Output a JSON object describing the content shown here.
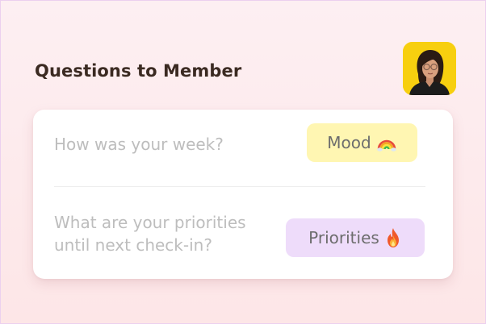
{
  "header": {
    "title": "Questions to Member"
  },
  "avatar": {
    "icon": "member-photo"
  },
  "questions": [
    {
      "text": "How was your week?",
      "tag": {
        "label": "Mood",
        "icon": "rainbow-icon",
        "color": "#fff6b2"
      }
    },
    {
      "text": "What are your priorities\nuntil next check-in?",
      "tag": {
        "label": "Priorities",
        "icon": "fire-icon",
        "color": "#eedcfa"
      }
    }
  ]
}
